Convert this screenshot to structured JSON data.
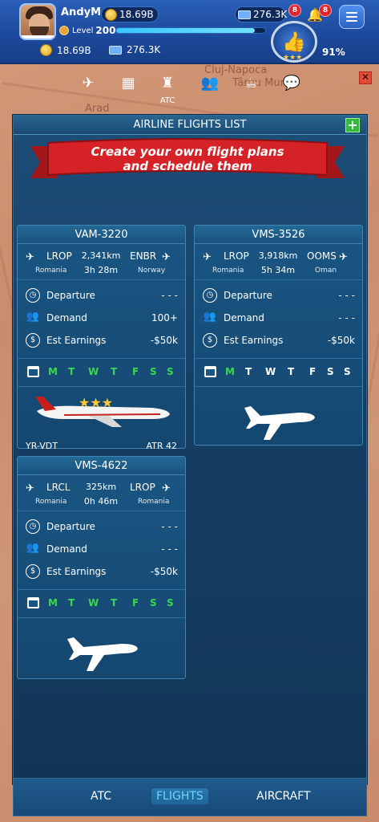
{
  "player": {
    "name": "AndyM",
    "coins_top": "18.69B",
    "cash_top": "276.3K",
    "level_label": "Level",
    "level": "200",
    "coins": "18.69B",
    "cash": "276.3K",
    "rating": "91%",
    "badge_cash": "8",
    "badge_bell": "8",
    "xp_fraction": 0.93
  },
  "map_labels": [
    "Cluj-Napoca",
    "Arad",
    "Târgu Mureș"
  ],
  "nav": {
    "icons": [
      "flights-icon",
      "airport-icon",
      "atc-tower-icon",
      "staff-icon",
      "coffee-icon",
      "chat-icon"
    ],
    "active_label": "ATC"
  },
  "panel": {
    "title": "AIRLINE FLIGHTS LIST",
    "banner_line1": "Create your own flight plans",
    "banner_line2": "and schedule them"
  },
  "cards": [
    {
      "flight": "VAM-3220",
      "from_code": "LROP",
      "from_country": "Romania",
      "dist": "2,341km",
      "time": "3h 28m",
      "to_code": "ENBR",
      "to_country": "Norway",
      "dep_label": "Departure",
      "dep": "- - -",
      "dem_label": "Demand",
      "dem": "100+",
      "earn_label": "Est Earnings",
      "earn": "-$50k",
      "days": [
        "M",
        "T",
        "W",
        "T",
        "F",
        "S",
        "S"
      ],
      "active_days": [
        true,
        true,
        true,
        true,
        true,
        true,
        true
      ],
      "reg": "YR-VDT",
      "model": "ATR 42",
      "stars": "★★★"
    },
    {
      "flight": "VMS-3526",
      "from_code": "LROP",
      "from_country": "Romania",
      "dist": "3,918km",
      "time": "5h 34m",
      "to_code": "OOMS",
      "to_country": "Oman",
      "dep_label": "Departure",
      "dep": "- - -",
      "dem_label": "Demand",
      "dem": "- - -",
      "earn_label": "Est Earnings",
      "earn": "-$50k",
      "days": [
        "M",
        "T",
        "W",
        "T",
        "F",
        "S",
        "S"
      ],
      "active_days": [
        true,
        false,
        false,
        false,
        false,
        false,
        false
      ]
    },
    {
      "flight": "VMS-4622",
      "from_code": "LRCL",
      "from_country": "Romania",
      "dist": "325km",
      "time": "0h 46m",
      "to_code": "LROP",
      "to_country": "Romania",
      "dep_label": "Departure",
      "dep": "- - -",
      "dem_label": "Demand",
      "dem": "- - -",
      "earn_label": "Est Earnings",
      "earn": "-$50k",
      "days": [
        "M",
        "T",
        "W",
        "T",
        "F",
        "S",
        "S"
      ],
      "active_days": [
        true,
        true,
        true,
        true,
        true,
        true,
        true
      ]
    }
  ],
  "tabs": {
    "atc": "ATC",
    "flights": "FLIGHTS",
    "aircraft": "AIRCRAFT"
  },
  "colors": {
    "active_day": "#3bd84a",
    "panel": "#163f66",
    "topbar": "#1c4a9c"
  }
}
